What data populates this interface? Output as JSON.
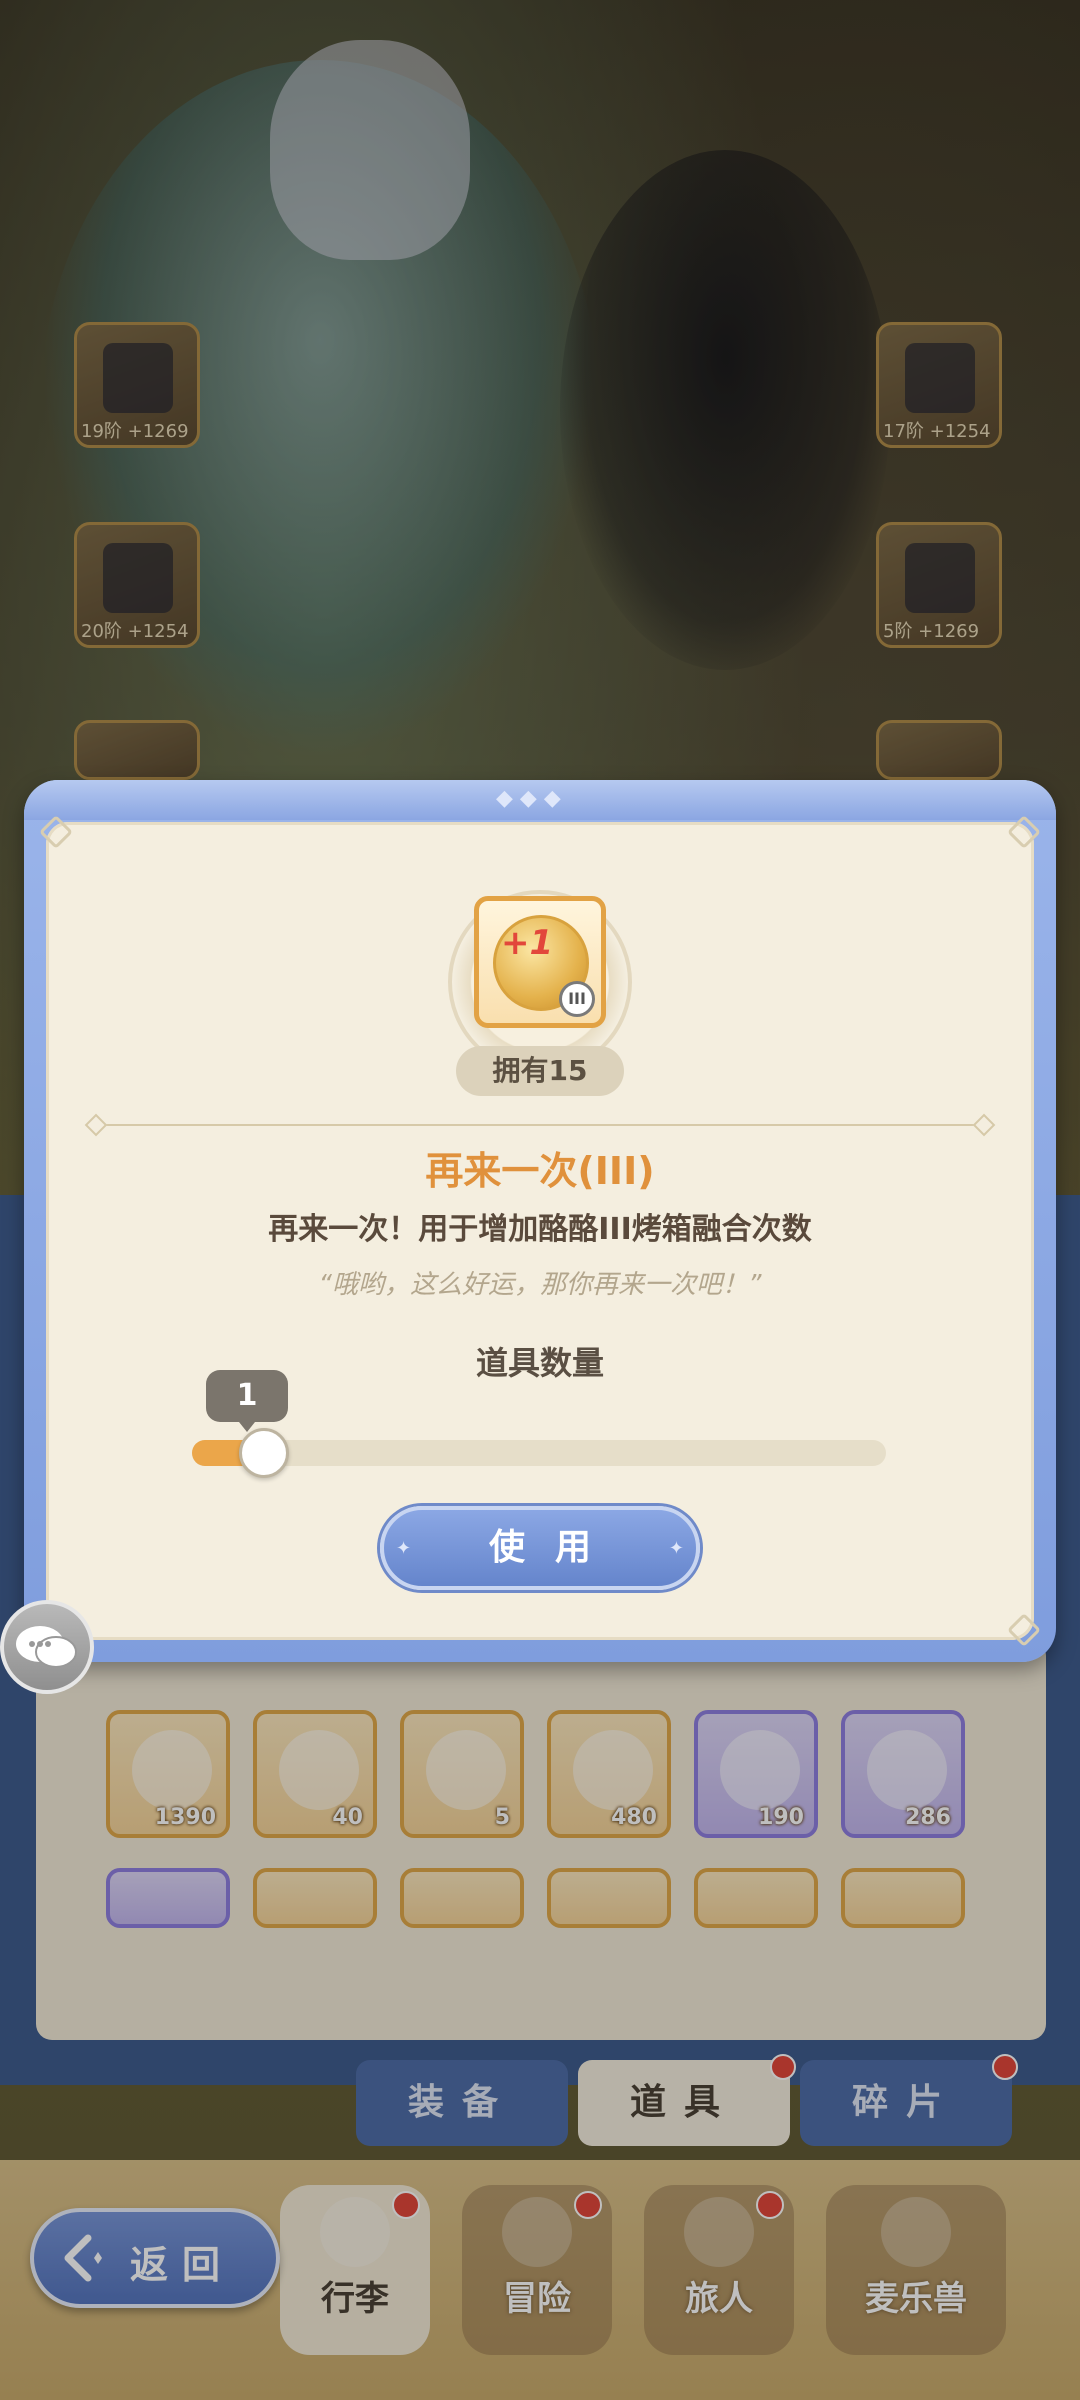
{
  "equipment_left": [
    {
      "label": "19阶 +1269"
    },
    {
      "label": "20阶 +1254"
    }
  ],
  "equipment_right": [
    {
      "label": "17阶 +1254"
    },
    {
      "label": "5阶 +1269"
    }
  ],
  "inventory": {
    "items": [
      {
        "qty": "1390",
        "style": "gold"
      },
      {
        "qty": "40",
        "style": "gold"
      },
      {
        "qty": "5",
        "style": "gold"
      },
      {
        "qty": "480",
        "style": "gold"
      },
      {
        "qty": "190",
        "style": "purple"
      },
      {
        "qty": "286",
        "style": "purple"
      }
    ],
    "tabs": [
      {
        "label": "装备",
        "active": false,
        "dot": false
      },
      {
        "label": "道具",
        "active": true,
        "dot": true
      },
      {
        "label": "碎片",
        "active": false,
        "dot": true
      }
    ]
  },
  "bottom_nav": [
    {
      "label": "行李",
      "selected": true,
      "dot": true
    },
    {
      "label": "冒险",
      "selected": false,
      "dot": true
    },
    {
      "label": "旅人",
      "selected": false,
      "dot": true
    },
    {
      "label": "麦乐兽",
      "selected": false,
      "dot": false
    }
  ],
  "back_button": {
    "label": "返回"
  },
  "modal": {
    "item_icon": {
      "text": "+1",
      "badge": "III"
    },
    "owned": "拥有15",
    "name": "再来一次(III)",
    "description": "再来一次！用于增加酪酪III烤箱融合次数",
    "quote": "“哦哟，这么好运，那你再来一次吧！”",
    "quantity_label": "道具数量",
    "quantity_value": "1",
    "slider_fraction": 0.08,
    "use_button": "使用"
  },
  "colors": {
    "accent_orange": "#e0913c",
    "modal_blue": "#7f9ddd",
    "panel_cream": "#f4eedf"
  }
}
